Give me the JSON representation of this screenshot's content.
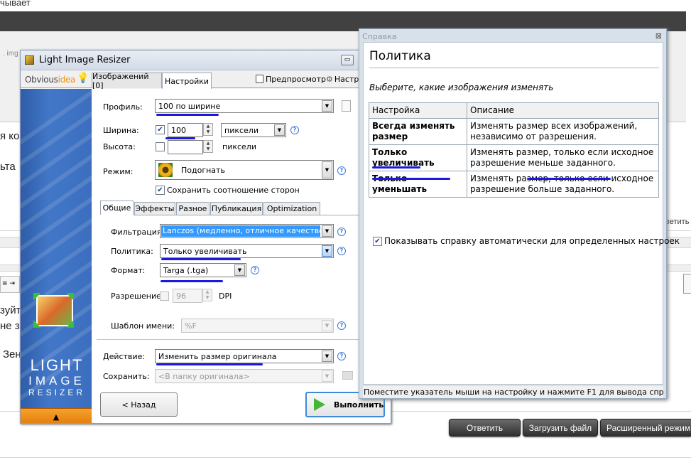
{
  "background": {
    "top_text": "чывает",
    "left_fragments": [
      "я ко",
      "ьта",
      "зуйт",
      "не за",
      "Зен"
    ],
    "right_fragment": "ветить",
    "buttons": {
      "reply": "Ответить",
      "upload": "Загрузить файл",
      "advanced": "Расширенный режим"
    }
  },
  "lir": {
    "title": "Light Image Resizer",
    "logo": {
      "part1": "Obvious",
      "part2": "idea"
    },
    "tabs": [
      "Изображений [0]",
      "Настройки"
    ],
    "preview_label": "Предпросмотр",
    "settings_cut": "Настр",
    "brand": {
      "line1": "LIGHT",
      "line2": "IMAGE",
      "line3": "RESIZER"
    },
    "profile": {
      "label": "Профиль:",
      "value": "100 по ширине"
    },
    "width": {
      "label": "Ширина:",
      "value": "100",
      "unit": "пиксели"
    },
    "height": {
      "label": "Высота:",
      "value": "",
      "unit": "пиксели"
    },
    "mode": {
      "label": "Режим:",
      "value": "Подогнать"
    },
    "keep_ratio": "Сохранить соотношение сторон",
    "subtabs": [
      "Общие",
      "Эффекты",
      "Разное",
      "Публикация",
      "Optimization"
    ],
    "filter": {
      "label": "Фильтрация:",
      "value": "Lanczos  (медленно, отличное качество)"
    },
    "policy": {
      "label": "Политика:",
      "value": "Только увеличивать"
    },
    "format": {
      "label": "Формат:",
      "value": "Targa (.tga)"
    },
    "resolution": {
      "label": "Разрешение:",
      "value": "96",
      "unit": "DPI"
    },
    "name_template": {
      "label": "Шаблон имени:",
      "value": "%F"
    },
    "action": {
      "label": "Действие:",
      "value": "Изменить размер оригинала"
    },
    "save": {
      "label": "Сохранить:",
      "value": "<В папку оригинала>"
    },
    "back_button": "< Назад",
    "run_button": "Выполнить"
  },
  "help": {
    "window_title": "Справка",
    "heading": "Политика",
    "subtitle": "Выберите, какие изображения изменять",
    "table": {
      "headers": [
        "Настройка",
        "Описание"
      ],
      "rows": [
        {
          "setting": "Всегда изменять размер",
          "desc": "Изменять размер всех изображений, независимо от разрешения."
        },
        {
          "setting": "Только увеличивать",
          "desc": "Изменять размер, только если исходное разрешение меньше заданного."
        },
        {
          "setting": "Только уменьшать",
          "desc": "Изменять размер, только если исходное разрешение больше заданного."
        }
      ]
    },
    "auto_show": "Показывать справку автоматически для определенных настроек",
    "status": "Поместите указатель мыши на настройку и нажмите F1 для вывода справ"
  },
  "colors": {
    "accent_underline": "#1a1adf",
    "brand_blue": "#3c6ebe",
    "brand_orange": "#f0900a",
    "selection": "#3399ff"
  }
}
